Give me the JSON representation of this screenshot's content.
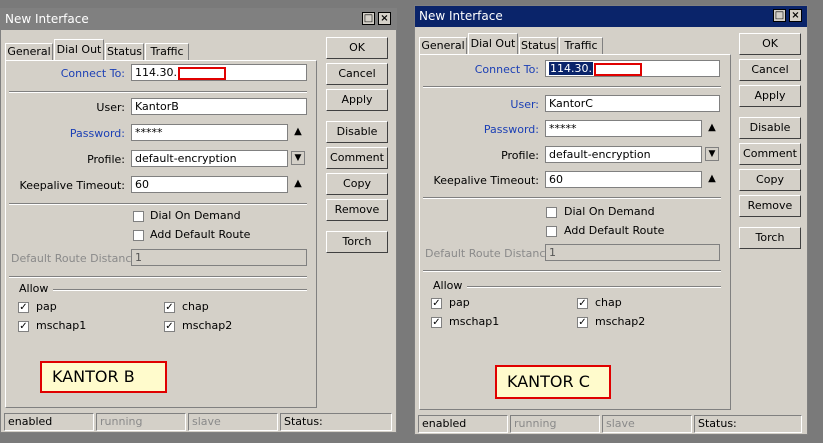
{
  "windows": [
    {
      "title": "New Interface",
      "tabs": [
        "General",
        "Dial Out",
        "Status",
        "Traffic"
      ],
      "active_tab": "Dial Out",
      "connect_to": {
        "label": "Connect To:",
        "value": "114.30."
      },
      "user": {
        "label": "User:",
        "value": "KantorB"
      },
      "password": {
        "label": "Password:",
        "value": "*****"
      },
      "profile": {
        "label": "Profile:",
        "value": "default-encryption"
      },
      "keepalive": {
        "label": "Keepalive Timeout:",
        "value": "60"
      },
      "dial_on_demand": {
        "label": "Dial On Demand",
        "checked": false
      },
      "add_default_route": {
        "label": "Add Default Route",
        "checked": false
      },
      "default_route_distance": {
        "label": "Default Route Distance:",
        "value": "1"
      },
      "allow": {
        "label": "Allow",
        "items": [
          {
            "label": "pap",
            "checked": true
          },
          {
            "label": "chap",
            "checked": true
          },
          {
            "label": "mschap1",
            "checked": true
          },
          {
            "label": "mschap2",
            "checked": true
          }
        ]
      },
      "buttons": [
        "OK",
        "Cancel",
        "Apply",
        "Disable",
        "Comment",
        "Copy",
        "Remove",
        "Torch"
      ],
      "annotation": "KANTOR B",
      "status_bar": [
        "enabled",
        "running",
        "slave",
        "Status:"
      ]
    },
    {
      "title": "New Interface",
      "tabs": [
        "General",
        "Dial Out",
        "Status",
        "Traffic"
      ],
      "active_tab": "Dial Out",
      "connect_to": {
        "label": "Connect To:",
        "value": "114.30."
      },
      "user": {
        "label": "User:",
        "value": "KantorC"
      },
      "password": {
        "label": "Password:",
        "value": "*****"
      },
      "profile": {
        "label": "Profile:",
        "value": "default-encryption"
      },
      "keepalive": {
        "label": "Keepalive Timeout:",
        "value": "60"
      },
      "dial_on_demand": {
        "label": "Dial On Demand",
        "checked": false
      },
      "add_default_route": {
        "label": "Add Default Route",
        "checked": false
      },
      "default_route_distance": {
        "label": "Default Route Distance:",
        "value": "1"
      },
      "allow": {
        "label": "Allow",
        "items": [
          {
            "label": "pap",
            "checked": true
          },
          {
            "label": "chap",
            "checked": true
          },
          {
            "label": "mschap1",
            "checked": true
          },
          {
            "label": "mschap2",
            "checked": true
          }
        ]
      },
      "buttons": [
        "OK",
        "Cancel",
        "Apply",
        "Disable",
        "Comment",
        "Copy",
        "Remove",
        "Torch"
      ],
      "annotation": "KANTOR C",
      "status_bar": [
        "enabled",
        "running",
        "slave",
        "Status:"
      ]
    }
  ],
  "icons": {
    "maximize": "maximize-icon",
    "close": "close-icon",
    "arrow_up": "arrow-up-icon",
    "dropdown": "chevron-down-icon",
    "check": "checkmark-icon"
  },
  "colors": {
    "active_title": "#0a246a",
    "inactive_title": "#808080",
    "highlight_label": "#1b3fb5",
    "annotation_border": "#e00000",
    "annotation_bg": "#fffbcc"
  }
}
